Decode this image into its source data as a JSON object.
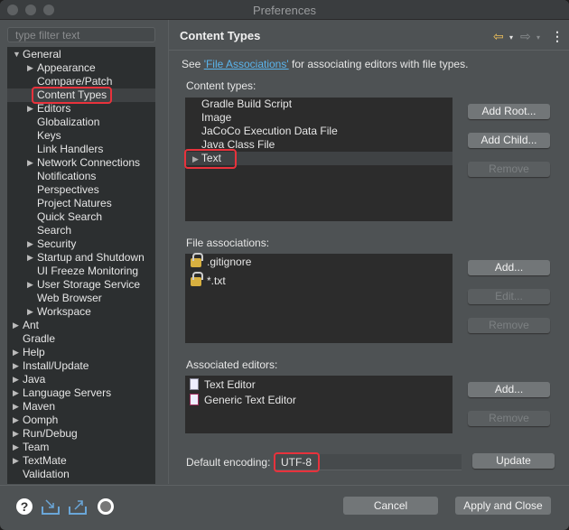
{
  "window": {
    "title": "Preferences"
  },
  "filter": {
    "placeholder": "type filter text"
  },
  "tree": [
    {
      "label": "General",
      "depth": 0,
      "arrow": "open"
    },
    {
      "label": "Appearance",
      "depth": 1,
      "arrow": "closed"
    },
    {
      "label": "Compare/Patch",
      "depth": 1,
      "arrow": ""
    },
    {
      "label": "Content Types",
      "depth": 1,
      "arrow": "",
      "selected": true
    },
    {
      "label": "Editors",
      "depth": 1,
      "arrow": "closed"
    },
    {
      "label": "Globalization",
      "depth": 1,
      "arrow": ""
    },
    {
      "label": "Keys",
      "depth": 1,
      "arrow": ""
    },
    {
      "label": "Link Handlers",
      "depth": 1,
      "arrow": ""
    },
    {
      "label": "Network Connections",
      "depth": 1,
      "arrow": "closed"
    },
    {
      "label": "Notifications",
      "depth": 1,
      "arrow": ""
    },
    {
      "label": "Perspectives",
      "depth": 1,
      "arrow": ""
    },
    {
      "label": "Project Natures",
      "depth": 1,
      "arrow": ""
    },
    {
      "label": "Quick Search",
      "depth": 1,
      "arrow": ""
    },
    {
      "label": "Search",
      "depth": 1,
      "arrow": ""
    },
    {
      "label": "Security",
      "depth": 1,
      "arrow": "closed"
    },
    {
      "label": "Startup and Shutdown",
      "depth": 1,
      "arrow": "closed"
    },
    {
      "label": "UI Freeze Monitoring",
      "depth": 1,
      "arrow": ""
    },
    {
      "label": "User Storage Service",
      "depth": 1,
      "arrow": "closed"
    },
    {
      "label": "Web Browser",
      "depth": 1,
      "arrow": ""
    },
    {
      "label": "Workspace",
      "depth": 1,
      "arrow": "closed"
    },
    {
      "label": "Ant",
      "depth": 0,
      "arrow": "closed"
    },
    {
      "label": "Gradle",
      "depth": 0,
      "arrow": ""
    },
    {
      "label": "Help",
      "depth": 0,
      "arrow": "closed"
    },
    {
      "label": "Install/Update",
      "depth": 0,
      "arrow": "closed"
    },
    {
      "label": "Java",
      "depth": 0,
      "arrow": "closed"
    },
    {
      "label": "Language Servers",
      "depth": 0,
      "arrow": "closed"
    },
    {
      "label": "Maven",
      "depth": 0,
      "arrow": "closed"
    },
    {
      "label": "Oomph",
      "depth": 0,
      "arrow": "closed"
    },
    {
      "label": "Run/Debug",
      "depth": 0,
      "arrow": "closed"
    },
    {
      "label": "Team",
      "depth": 0,
      "arrow": "closed"
    },
    {
      "label": "TextMate",
      "depth": 0,
      "arrow": "closed"
    },
    {
      "label": "Validation",
      "depth": 0,
      "arrow": ""
    }
  ],
  "page": {
    "title": "Content Types",
    "see_prefix": "See ",
    "see_link": "'File Associations'",
    "see_suffix": " for associating editors with file types.",
    "content_types_label": "Content types:",
    "content_types": [
      "Gradle Build Script",
      "Image",
      "JaCoCo Execution Data File",
      "Java Class File",
      "Text"
    ],
    "ct_buttons": {
      "add_root": "Add Root...",
      "add_child": "Add Child...",
      "remove": "Remove"
    },
    "file_assoc_label": "File associations:",
    "file_assocs": [
      ".gitignore",
      "*.txt"
    ],
    "fa_buttons": {
      "add": "Add...",
      "edit": "Edit...",
      "remove": "Remove"
    },
    "editors_label": "Associated editors:",
    "editors": [
      "Text Editor",
      "Generic Text Editor"
    ],
    "ed_buttons": {
      "add": "Add...",
      "remove": "Remove"
    },
    "encoding_label": "Default encoding:",
    "encoding_value": "UTF-8",
    "update": "Update"
  },
  "footer": {
    "cancel": "Cancel",
    "apply_close": "Apply and Close"
  },
  "colors": {
    "highlight": "#e8323c",
    "link": "#5ab4ec",
    "back_arrow": "#f2c25a"
  }
}
